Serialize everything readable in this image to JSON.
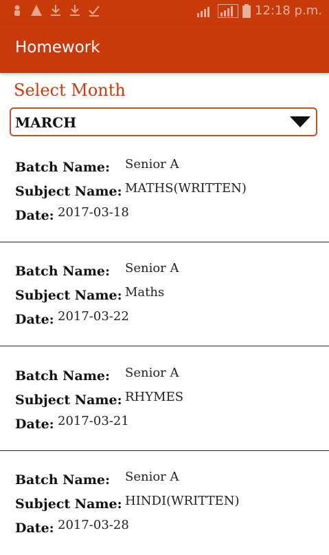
{
  "status_bar": {
    "time": "12:18 p.m."
  },
  "app_bar": {
    "title": "Homework"
  },
  "filter": {
    "label": "Select Month",
    "selected_month": "MARCH"
  },
  "field_labels": {
    "batch": "Batch Name:",
    "subject": "Subject Name:",
    "date": "Date:"
  },
  "homework": [
    {
      "batch": "Senior A",
      "subject": "MATHS(WRITTEN)",
      "date": "2017-03-18"
    },
    {
      "batch": "Senior A",
      "subject": "Maths",
      "date": "2017-03-22"
    },
    {
      "batch": "Senior A",
      "subject": "RHYMES",
      "date": "2017-03-21"
    },
    {
      "batch": "Senior A",
      "subject": "HINDI(WRITTEN)",
      "date": "2017-03-28"
    }
  ],
  "colors": {
    "primary": "#c83a0a",
    "divider": "#222222"
  }
}
